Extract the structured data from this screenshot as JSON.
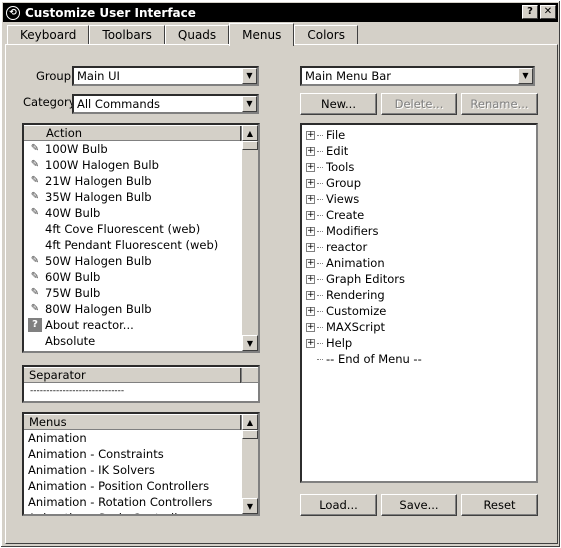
{
  "window": {
    "title": "Customize User Interface",
    "help_label": "?",
    "close_label": "✕"
  },
  "tabs": [
    {
      "label": "Keyboard"
    },
    {
      "label": "Toolbars"
    },
    {
      "label": "Quads"
    },
    {
      "label": "Menus",
      "active": true
    },
    {
      "label": "Colors"
    }
  ],
  "left": {
    "group_label": "Group:",
    "group_value": "Main UI",
    "category_label": "Category:",
    "category_value": "All Commands",
    "action_header": "Action",
    "actions": [
      {
        "label": "100W Bulb",
        "icon": "light-bulb-icon"
      },
      {
        "label": "100W Halogen Bulb",
        "icon": "light-bulb-icon"
      },
      {
        "label": "21W Halogen Bulb",
        "icon": "light-bulb-icon"
      },
      {
        "label": "35W Halogen Bulb",
        "icon": "light-bulb-icon"
      },
      {
        "label": "40W Bulb",
        "icon": "light-bulb-icon"
      },
      {
        "label": "4ft Cove Fluorescent (web)",
        "icon": ""
      },
      {
        "label": "4ft Pendant Fluorescent (web)",
        "icon": ""
      },
      {
        "label": "50W Halogen Bulb",
        "icon": "light-bulb-icon"
      },
      {
        "label": "60W Bulb",
        "icon": "light-bulb-icon"
      },
      {
        "label": "75W Bulb",
        "icon": "light-bulb-icon"
      },
      {
        "label": "80W Halogen Bulb",
        "icon": "light-bulb-icon"
      },
      {
        "label": "About reactor...",
        "icon": "help-icon"
      },
      {
        "label": "Absolute",
        "icon": ""
      }
    ],
    "separator_header": "Separator",
    "separator_item": "-----------------------------",
    "menus_header": "Menus",
    "menus": [
      "Animation",
      "Animation - Constraints",
      "Animation - IK Solvers",
      "Animation - Position Controllers",
      "Animation - Rotation Controllers",
      "Animation - Scale Controllers"
    ]
  },
  "right": {
    "menu_select_value": "Main Menu Bar",
    "new_label": "New...",
    "delete_label": "Delete...",
    "rename_label": "Rename...",
    "tree_items": [
      "File",
      "Edit",
      "Tools",
      "Group",
      "Views",
      "Create",
      "Modifiers",
      "reactor",
      "Animation",
      "Graph Editors",
      "Rendering",
      "Customize",
      "MAXScript",
      "Help"
    ],
    "end_item": "-- End of Menu --",
    "load_label": "Load...",
    "save_label": "Save...",
    "reset_label": "Reset"
  }
}
